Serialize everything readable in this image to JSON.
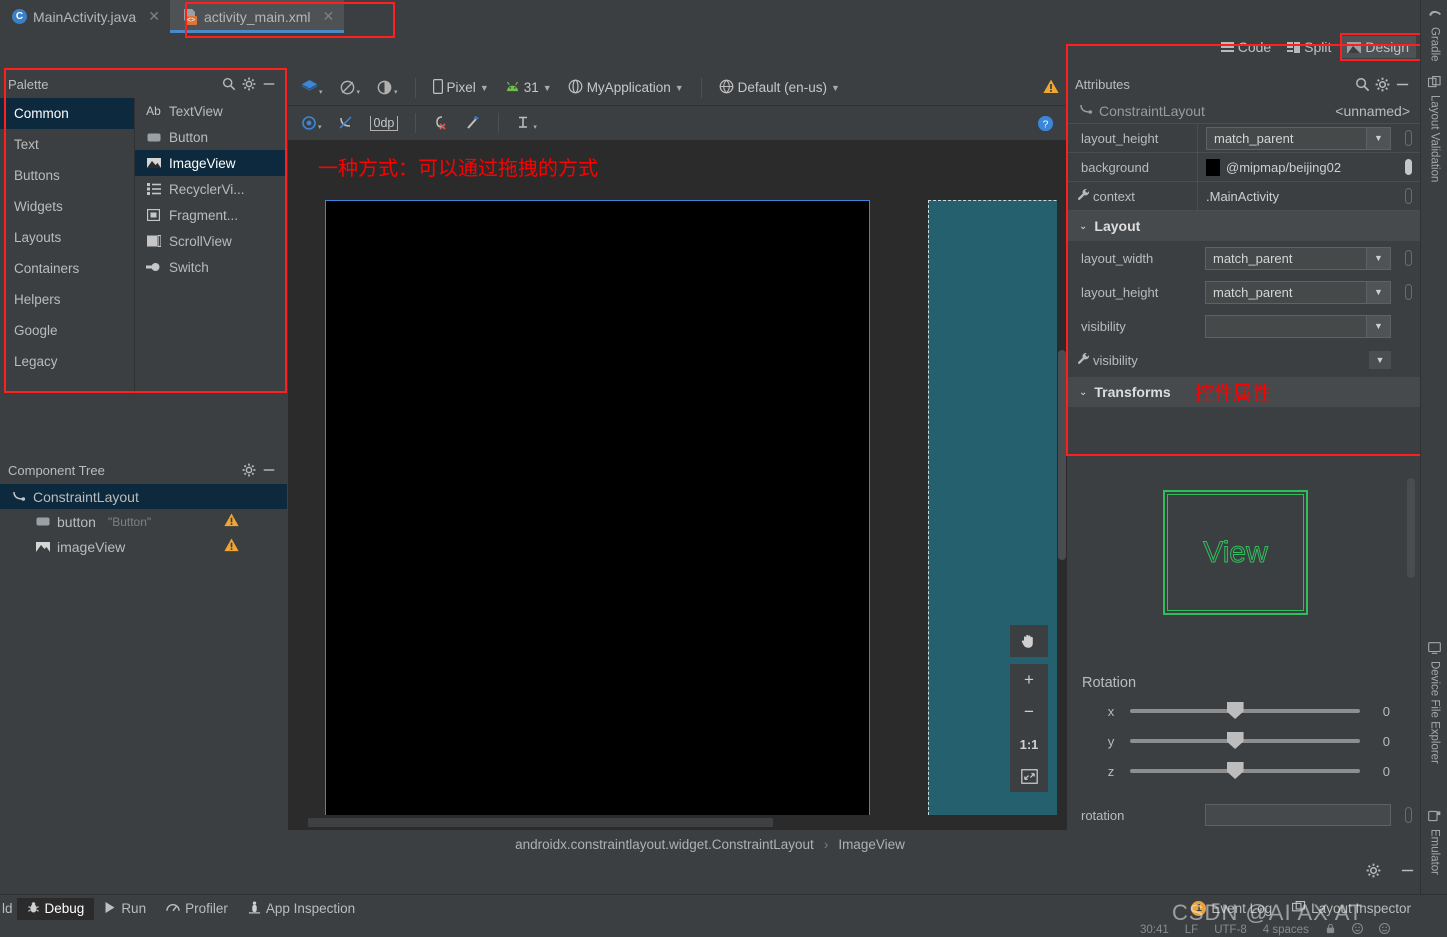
{
  "tabs": [
    {
      "label": "MainActivity.java",
      "icon": "java-class-icon",
      "active": false
    },
    {
      "label": "activity_main.xml",
      "icon": "xml-layout-icon",
      "active": true
    }
  ],
  "editor_modes": [
    {
      "label": "Code",
      "icon": "code-lines-icon",
      "selected": false
    },
    {
      "label": "Split",
      "icon": "split-view-icon",
      "selected": false
    },
    {
      "label": "Design",
      "icon": "design-image-icon",
      "selected": true
    }
  ],
  "palette": {
    "title": "Palette",
    "search_icon": "search-icon",
    "gear_icon": "gear-icon",
    "minimize_icon": "minimize-icon",
    "categories": [
      {
        "label": "Common",
        "selected": true
      },
      {
        "label": "Text",
        "selected": false
      },
      {
        "label": "Buttons",
        "selected": false
      },
      {
        "label": "Widgets",
        "selected": false
      },
      {
        "label": "Layouts",
        "selected": false
      },
      {
        "label": "Containers",
        "selected": false
      },
      {
        "label": "Helpers",
        "selected": false
      },
      {
        "label": "Google",
        "selected": false
      },
      {
        "label": "Legacy",
        "selected": false
      }
    ],
    "items": [
      {
        "label": "TextView",
        "icon": "textview-icon",
        "selected": false
      },
      {
        "label": "Button",
        "icon": "button-icon",
        "selected": false
      },
      {
        "label": "ImageView",
        "icon": "imageview-icon",
        "selected": true
      },
      {
        "label": "RecyclerVi...",
        "icon": "recyclerview-icon",
        "selected": false
      },
      {
        "label": "Fragment...",
        "icon": "fragment-icon",
        "selected": false
      },
      {
        "label": "ScrollView",
        "icon": "scrollview-icon",
        "selected": false
      },
      {
        "label": "Switch",
        "icon": "switch-icon",
        "selected": false
      }
    ]
  },
  "component_tree": {
    "title": "Component Tree",
    "gear_icon": "gear-icon",
    "minimize_icon": "minimize-icon",
    "rows": [
      {
        "label": "ConstraintLayout",
        "note": "",
        "icon": "constraintlayout-icon",
        "selected": true,
        "warning": false
      },
      {
        "label": "button",
        "note": "\"Button\"",
        "icon": "button-icon",
        "selected": false,
        "warning": true
      },
      {
        "label": "imageView",
        "note": "",
        "icon": "imageview-icon",
        "selected": false,
        "warning": true
      }
    ]
  },
  "design_toolbar": {
    "row1": [
      {
        "label": "",
        "icon": "design-surface-icon"
      },
      {
        "label": "",
        "icon": "orientation-icon"
      },
      {
        "label": "",
        "icon": "theme-icon"
      },
      {
        "label": "Pixel",
        "icon": "device-icon"
      },
      {
        "label": "31",
        "icon": "android-api-icon"
      },
      {
        "label": "MyApplication",
        "icon": "theme-circle-icon"
      },
      {
        "label": "Default (en-us)",
        "icon": "locale-globe-icon"
      }
    ],
    "warning_icon": "warning-triangle-icon",
    "row2": [
      {
        "label": "",
        "icon": "show-constraints-icon"
      },
      {
        "label": "",
        "icon": "autoconnect-off-icon"
      },
      {
        "label": "0dp",
        "icon": "default-margin-icon"
      },
      {
        "label": "",
        "icon": "clear-constraints-icon"
      },
      {
        "label": "",
        "icon": "infer-constraints-icon"
      },
      {
        "label": "",
        "icon": "guideline-icon"
      }
    ],
    "help_icon": "help-circle-icon"
  },
  "canvas": {
    "annotation": "一种方式：可以通过拖拽的方式",
    "wrench_icon": "wrench-icon",
    "zoom_controls": [
      {
        "label": "",
        "icon": "pan-hand-icon"
      },
      {
        "label": "+",
        "icon": "zoom-in-icon"
      },
      {
        "label": "−",
        "icon": "zoom-out-icon"
      },
      {
        "label": "1:1",
        "icon": "zoom-actual-icon"
      },
      {
        "label": "",
        "icon": "zoom-fit-icon"
      }
    ]
  },
  "attributes": {
    "title": "Attributes",
    "search_icon": "search-icon",
    "gear_icon": "gear-icon",
    "minimize_icon": "minimize-icon",
    "component": {
      "type": "ConstraintLayout",
      "id": "<unnamed>",
      "icon": "constraintlayout-icon"
    },
    "top_rows": [
      {
        "name": "layout_height",
        "value": "match_parent",
        "kind": "combo",
        "wrench": false,
        "pin": "empty"
      },
      {
        "name": "background",
        "value": "@mipmap/beijing02",
        "kind": "color",
        "wrench": false,
        "pin": "filled",
        "swatch": "#000000"
      },
      {
        "name": "context",
        "value": ".MainActivity",
        "kind": "text",
        "wrench": true,
        "pin": "empty"
      }
    ],
    "sections": [
      {
        "title": "Layout",
        "rows": [
          {
            "name": "layout_width",
            "value": "match_parent",
            "kind": "combo",
            "wrench": false,
            "pin": "empty"
          },
          {
            "name": "layout_height",
            "value": "match_parent",
            "kind": "combo",
            "wrench": false,
            "pin": "empty"
          },
          {
            "name": "visibility",
            "value": "",
            "kind": "combo",
            "wrench": false,
            "pin": "none"
          },
          {
            "name": "visibility",
            "value": "",
            "kind": "flatcombo",
            "wrench": true,
            "pin": "none"
          }
        ]
      },
      {
        "title": "Transforms",
        "rows": []
      }
    ],
    "annotation": "控件属性",
    "view_preview_label": "View",
    "rotation": {
      "title": "Rotation",
      "axes": [
        {
          "label": "x",
          "value": "0"
        },
        {
          "label": "y",
          "value": "0"
        },
        {
          "label": "z",
          "value": "0"
        }
      ]
    },
    "rotation_field": {
      "name": "rotation",
      "value": ""
    }
  },
  "right_tool_tabs": [
    {
      "label": "Gradle",
      "icon": "gradle-elephant-icon"
    },
    {
      "label": "Layout Validation",
      "icon": "layout-validation-icon"
    },
    {
      "label": "Device File Explorer",
      "icon": "device-file-explorer-icon"
    },
    {
      "label": "Emulator",
      "icon": "emulator-icon"
    }
  ],
  "breadcrumb": {
    "parent": "androidx.constraintlayout.widget.ConstraintLayout",
    "separator": "›",
    "child": "ImageView"
  },
  "bottom_tool_icons": [
    {
      "icon": "gear-icon"
    },
    {
      "icon": "minimize-icon"
    }
  ],
  "status_bar": {
    "items": [
      {
        "label": "ld",
        "icon": "",
        "selected": false
      },
      {
        "label": "Debug",
        "icon": "debug-bug-icon",
        "selected": true
      },
      {
        "label": "Run",
        "icon": "run-play-icon",
        "selected": false
      },
      {
        "label": "Profiler",
        "icon": "profiler-gauge-icon",
        "selected": false
      },
      {
        "label": "App Inspection",
        "icon": "app-inspection-icon",
        "selected": false
      }
    ],
    "right_items": [
      {
        "label": "Event Log",
        "icon": "event-log-icon",
        "badge": "1"
      },
      {
        "label": "Layout Inspector",
        "icon": "layout-inspector-icon",
        "badge": ""
      }
    ]
  },
  "status_bar2": {
    "position": "30:41",
    "line_sep": "LF",
    "encoding": "UTF-8",
    "indent": "4 spaces"
  },
  "watermark": "CSDN @AI AX AT",
  "colors": {
    "accent_blue": "#3b86d8",
    "selection_blue": "#0d293e",
    "blueprint_teal": "#25606f",
    "annotation_red": "#ff0000",
    "warning_orange": "#f0a732",
    "view_green": "#2fbf5a",
    "panel_bg": "#3c3f41",
    "canvas_bg": "#2b2b2b"
  }
}
